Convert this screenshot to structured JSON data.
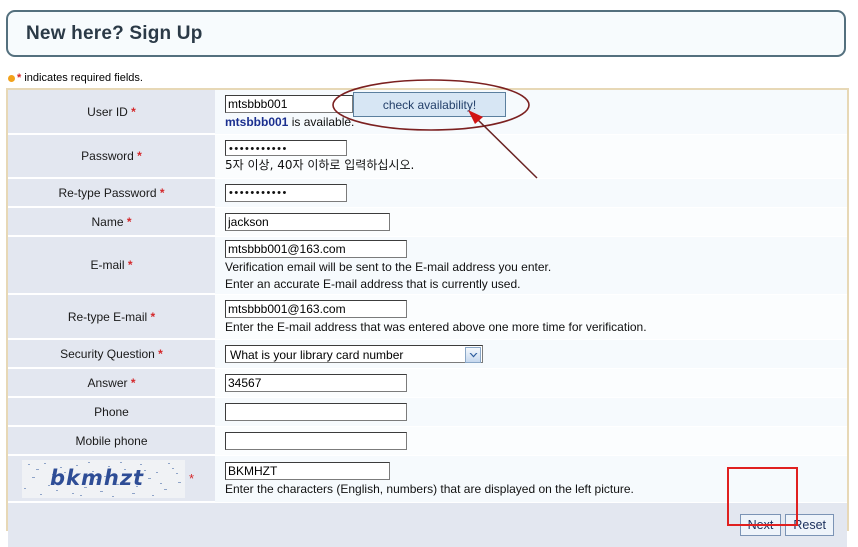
{
  "header": {
    "title": "New here? Sign Up"
  },
  "required_note": {
    "star": "*",
    "text": " indicates required fields."
  },
  "form": {
    "rows": [
      {
        "label": "User ID",
        "required": true,
        "value": "mtsbbb001",
        "status_name": "mtsbbb001",
        "status_rest": " is available."
      },
      {
        "label": "Password",
        "required": true,
        "value": "•••••••••••",
        "hint": "5자 이상, 40자 이하로 입력하십시오."
      },
      {
        "label": "Re-type Password",
        "required": true,
        "value": "•••••••••••"
      },
      {
        "label": "Name",
        "required": true,
        "value": "jackson"
      },
      {
        "label": "E-mail",
        "required": true,
        "value": "mtsbbb001@163.com",
        "hint": "Verification email will be sent to the E-mail address you enter.",
        "hint2": "Enter an accurate E-mail address that is currently used."
      },
      {
        "label": "Re-type E-mail",
        "required": true,
        "value": "mtsbbb001@163.com",
        "hint": "Enter the E-mail address that was entered above one more time for verification."
      },
      {
        "label": "Security Question",
        "required": true,
        "selected": "What is your library card number"
      },
      {
        "label": "Answer",
        "required": true,
        "value": "34567"
      },
      {
        "label": "Phone",
        "required": false,
        "value": ""
      },
      {
        "label": "Mobile phone",
        "required": false,
        "value": ""
      },
      {
        "label": "",
        "required": true,
        "captcha_text": "bkmhzt",
        "value": "BKMHZT",
        "hint": "Enter the characters (English, numbers) that are displayed on the left picture."
      }
    ]
  },
  "buttons": {
    "check_availability": "check availability!",
    "next": "Next",
    "reset": "Reset"
  },
  "colors": {
    "annotation_red": "#e02020",
    "annotation_ellipse": "#7b2020",
    "label_bg": "#e3e7f0",
    "required_star": "#d4282b",
    "bullet": "#f2a21c",
    "header_border": "#54707e",
    "table_border": "#e7d8b6",
    "captcha_text": "#2e4d96"
  }
}
